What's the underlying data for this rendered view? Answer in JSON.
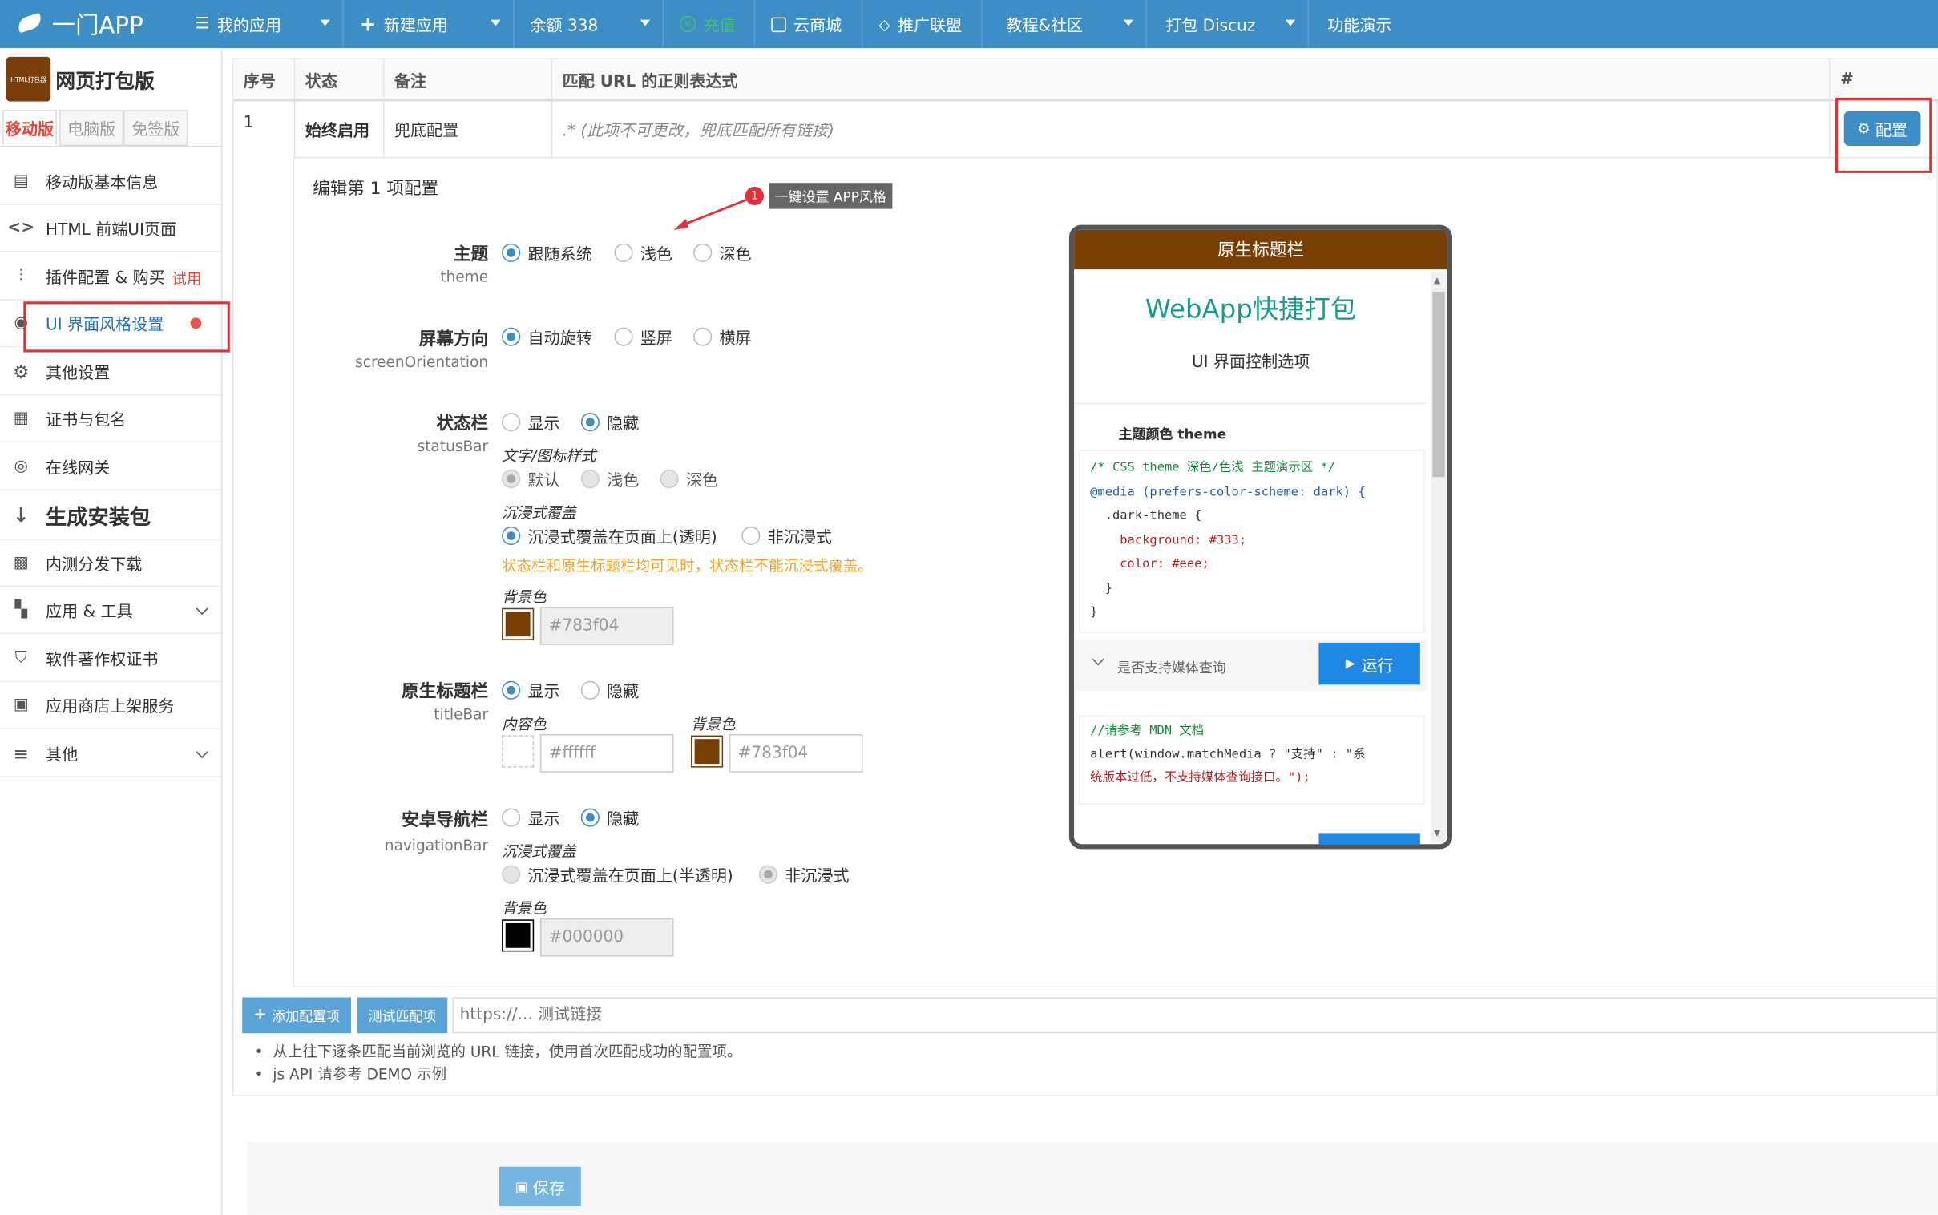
{
  "topnav": {
    "logo": "一门APP",
    "items": [
      {
        "label": "我的应用",
        "icon": "list-icon"
      },
      {
        "label": "新建应用",
        "icon": "plus-icon"
      },
      {
        "label": "余额 338",
        "icon": ""
      },
      {
        "label": "充值",
        "icon": "yen-icon"
      },
      {
        "label": "云商城",
        "icon": "store-icon"
      },
      {
        "label": "推广联盟",
        "icon": "diamond-icon"
      },
      {
        "label": "教程&社区",
        "icon": ""
      },
      {
        "label": "打包 Discuz",
        "icon": ""
      },
      {
        "label": "功能演示",
        "icon": ""
      }
    ],
    "recharge_color": "#43c463"
  },
  "sidebar": {
    "app_icon_text": "HTML打包器",
    "app_name": "网页打包版",
    "version_tabs": [
      "移动版",
      "电脑版",
      "免签版"
    ],
    "items": [
      {
        "label": "移动版基本信息",
        "icon": "document-icon"
      },
      {
        "label": "HTML 前端UI页面",
        "icon": "code-icon"
      },
      {
        "label": "插件配置 & 购买",
        "icon": "sliders-icon",
        "badge": "试用"
      },
      {
        "label": "UI 界面风格设置",
        "icon": "palette-icon"
      },
      {
        "label": "其他设置",
        "icon": "gear-icon"
      },
      {
        "label": "证书与包名",
        "icon": "certificate-icon"
      },
      {
        "label": "在线网关",
        "icon": "globe-icon"
      },
      {
        "label": "生成安装包",
        "icon": "download-sort-icon"
      },
      {
        "label": "内测分发下载",
        "icon": "qrcode-icon"
      },
      {
        "label": "应用 & 工具",
        "icon": "apps-icon"
      },
      {
        "label": "软件著作权证书",
        "icon": "shield-icon"
      },
      {
        "label": "应用商店上架服务",
        "icon": "store-app-icon"
      },
      {
        "label": "其他",
        "icon": "menu-icon"
      }
    ]
  },
  "table": {
    "headers": [
      "序号",
      "状态",
      "备注",
      "匹配 URL 的正则表达式",
      "#"
    ],
    "row": {
      "index": "1",
      "status": "始终启用",
      "note": "兜底配置",
      "regex": ".* (此项不可更改，兜底匹配所有链接)"
    },
    "config_button": "配置"
  },
  "edit": {
    "title": "编辑第 1 项配置",
    "tooltip_badge": "1",
    "tooltip_text": "一键设置 APP风格",
    "theme": {
      "label": "主题",
      "sub": "theme",
      "options": [
        "跟随系统",
        "浅色",
        "深色"
      ],
      "selected": "跟随系统"
    },
    "orientation": {
      "label": "屏幕方向",
      "sub": "screenOrientation",
      "options": [
        "自动旋转",
        "竖屏",
        "横屏"
      ],
      "selected": "自动旋转"
    },
    "statusbar": {
      "label": "状态栏",
      "sub": "statusBar",
      "options": [
        "显示",
        "隐藏"
      ],
      "selected": "隐藏",
      "text_style_label": "文字/图标样式",
      "text_style_options": [
        "默认",
        "浅色",
        "深色"
      ],
      "text_style_selected": "默认",
      "immersive_label": "沉浸式覆盖",
      "immersive_options": [
        "沉浸式覆盖在页面上(透明)",
        "非沉浸式"
      ],
      "immersive_selected": "沉浸式覆盖在页面上(透明)",
      "warning": "状态栏和原生标题栏均可见时，状态栏不能沉浸式覆盖。",
      "bg_label": "背景色",
      "bg_value": "#783f04"
    },
    "titlebar": {
      "label": "原生标题栏",
      "sub": "titleBar",
      "options": [
        "显示",
        "隐藏"
      ],
      "selected": "显示",
      "content_color_label": "内容色",
      "content_color": "#ffffff",
      "bg_label": "背景色",
      "bg_value": "#783f04"
    },
    "navbar": {
      "label": "安卓导航栏",
      "sub": "navigationBar",
      "options": [
        "显示",
        "隐藏"
      ],
      "selected": "隐藏",
      "immersive_label": "沉浸式覆盖",
      "immersive_options": [
        "沉浸式覆盖在页面上(半透明)",
        "非沉浸式"
      ],
      "immersive_selected": "非沉浸式",
      "bg_label": "背景色",
      "bg_value": "#000000"
    }
  },
  "phone": {
    "titlebar": "原生标题栏",
    "heading": "WebApp快捷打包",
    "subheading": "UI 界面控制选项",
    "section_title": "主题颜色 theme",
    "code_lines": [
      "/* CSS theme 深色/色浅 主题演示区 */",
      "@media (prefers-color-scheme: dark) {",
      "  .dark-theme {",
      "    background: #333;",
      "    color: #eee;",
      "  }",
      "}"
    ],
    "query_label": "是否支持媒体查询",
    "run_button": "运行",
    "code2_lines": [
      "//请参考 MDN 文档",
      "alert(window.matchMedia ? \"支持\" : \"系",
      "统版本过低，不支持媒体查询接口。\");"
    ]
  },
  "bottom": {
    "add_button": "添加配置项",
    "test_button": "测试匹配项",
    "test_placeholder": "https://... 测试链接",
    "notes": [
      "从上往下逐条匹配当前浏览的 URL 链接，使用首次匹配成功的配置项。",
      "js API 请参考 DEMO 示例"
    ],
    "save_button": "保存"
  },
  "colors": {
    "nav_bg": "#3e8ec6",
    "brand_brown": "#783f04",
    "accent": "#3e8ec6",
    "warning": "#f0a22a",
    "highlight_red": "#e0313b"
  }
}
